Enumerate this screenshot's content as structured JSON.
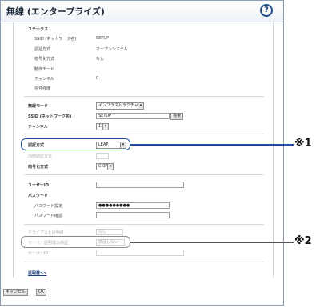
{
  "title": "無線 (エンタープライズ)",
  "help_label": "?",
  "status": {
    "heading": "ステータス",
    "rows": [
      {
        "label": "SSID (ネットワーク名)",
        "value": "SETUP"
      },
      {
        "label": "認証方式",
        "value": "オープンシステム"
      },
      {
        "label": "暗号化方式",
        "value": "なし"
      },
      {
        "label": "動作モード",
        "value": ""
      },
      {
        "label": "チャンネル",
        "value": "0"
      },
      {
        "label": "信号強度",
        "value": ""
      }
    ]
  },
  "settings": {
    "mode_label": "無線モード",
    "mode_value": "インフラストラクチャー",
    "ssid_label": "SSID (ネットワーク名)",
    "ssid_value": "SETUP",
    "search_button": "検索",
    "channel_label": "チャンネル",
    "channel_value": "11",
    "auth_label": "認証方式",
    "auth_value": "LEAP",
    "inner_auth_label": "内部認証方式",
    "inner_auth_value": "",
    "enc_label": "暗号化方式",
    "enc_value": "CKIP"
  },
  "credentials": {
    "user_id_label": "ユーザーID",
    "user_id_value": "",
    "password_heading": "パスワード",
    "password_label": "パスワード設定",
    "password_value": "●●●●●●●●●",
    "password_confirm_label": "パスワード確認",
    "password_confirm_value": ""
  },
  "certificate": {
    "client_cert_label": "クライアント証明書",
    "client_cert_value": "なし",
    "server_verify_label": "サーバー証明書の検証",
    "server_verify_value": "検証しない",
    "server_id_label": "サーバーID",
    "server_id_value": ""
  },
  "cert_link": "証明書>>",
  "buttons": {
    "cancel": "キャンセル",
    "ok": "OK"
  },
  "callouts": {
    "first": "※1",
    "second": "※2"
  }
}
